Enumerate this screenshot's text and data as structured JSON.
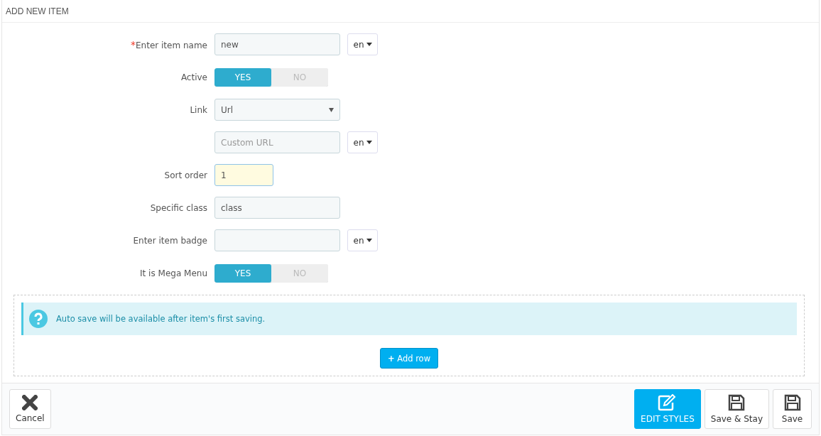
{
  "panel": {
    "title": "ADD NEW ITEM"
  },
  "rows": [
    {
      "kind": "text",
      "label": "Enter item name",
      "required_mark": "*",
      "value": "new",
      "lang": "en"
    },
    {
      "kind": "switch",
      "label": "Active",
      "options": [
        {
          "label": "YES",
          "selected": true
        },
        {
          "label": "NO",
          "selected": false
        }
      ]
    },
    {
      "kind": "select",
      "label": "Link",
      "value": "Url"
    },
    {
      "kind": "text",
      "placeholder": "Custom URL",
      "lang": "en"
    },
    {
      "kind": "number",
      "label": "Sort order",
      "value": "1"
    },
    {
      "kind": "text",
      "label": "Specific class",
      "value": "class"
    },
    {
      "kind": "text",
      "label": "Enter item badge",
      "lang": "en"
    },
    {
      "kind": "switch",
      "label": "It is Mega Menu",
      "options": [
        {
          "label": "YES",
          "selected": true
        },
        {
          "label": "NO",
          "selected": false
        }
      ]
    }
  ],
  "notice": {
    "text": "Auto save will be available after item's first saving."
  },
  "add_row": {
    "icon": "+",
    "label": "Add row"
  },
  "footer": {
    "left": [
      {
        "kind": "cancel",
        "label": "Cancel",
        "primary": false
      }
    ],
    "right": [
      {
        "kind": "edit",
        "label": "EDIT STYLES",
        "primary": true
      },
      {
        "kind": "save",
        "label": "Save & Stay",
        "primary": false
      },
      {
        "kind": "save",
        "label": "Save",
        "primary": false
      }
    ]
  }
}
